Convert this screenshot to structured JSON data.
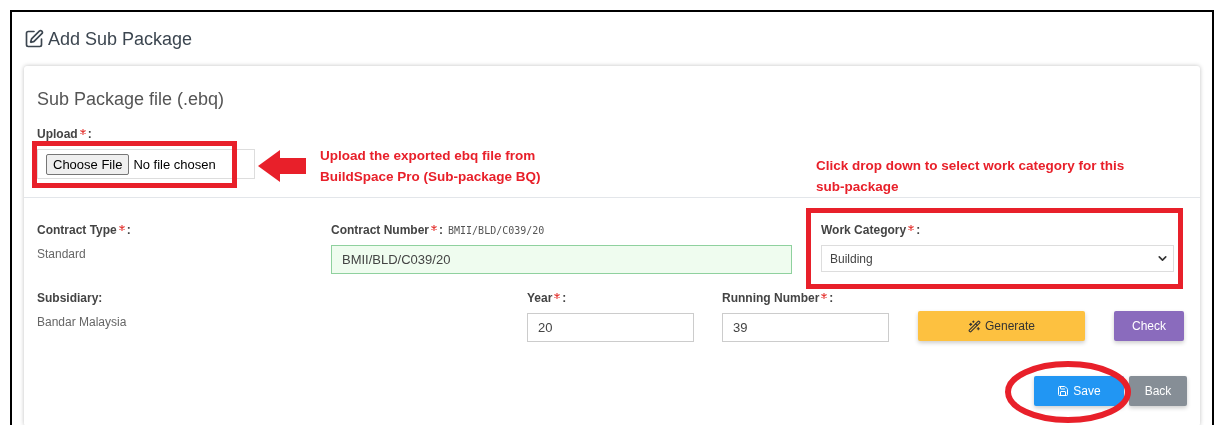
{
  "page": {
    "title": "Add Sub Package"
  },
  "upload_section": {
    "title": "Sub Package file (.ebq)",
    "label": "Upload",
    "required": true,
    "suffix": ":",
    "button": "Choose File",
    "status": "No file chosen"
  },
  "contract_type": {
    "label": "Contract Type",
    "required": true,
    "suffix": ":",
    "value": "Standard"
  },
  "contract_number": {
    "label": "Contract Number",
    "required": true,
    "suffix": ":",
    "hint": "BMII/BLD/C039/20",
    "value": "BMII/BLD/C039/20",
    "valid": true
  },
  "work_category": {
    "label": "Work Category",
    "required": true,
    "suffix": ":",
    "value": "Building"
  },
  "subsidiary": {
    "label": "Subsidiary:",
    "value": "Bandar Malaysia"
  },
  "year": {
    "label": "Year",
    "required": true,
    "suffix": ":",
    "value": "20"
  },
  "running_number": {
    "label": "Running Number",
    "required": true,
    "suffix": ":",
    "value": "39"
  },
  "buttons": [
    {
      "kind": "generate",
      "label": "Generate"
    },
    {
      "kind": "check",
      "label": "Check"
    },
    {
      "kind": "save",
      "label": "Save"
    },
    {
      "kind": "back",
      "label": "Back"
    }
  ],
  "annotations": [
    {
      "kind": "upload-note",
      "text": "Upload the exported ebq file from BuildSpace Pro (Sub-package BQ)"
    },
    {
      "kind": "category-note",
      "text": "Click drop down to select work category for this sub-package"
    }
  ]
}
